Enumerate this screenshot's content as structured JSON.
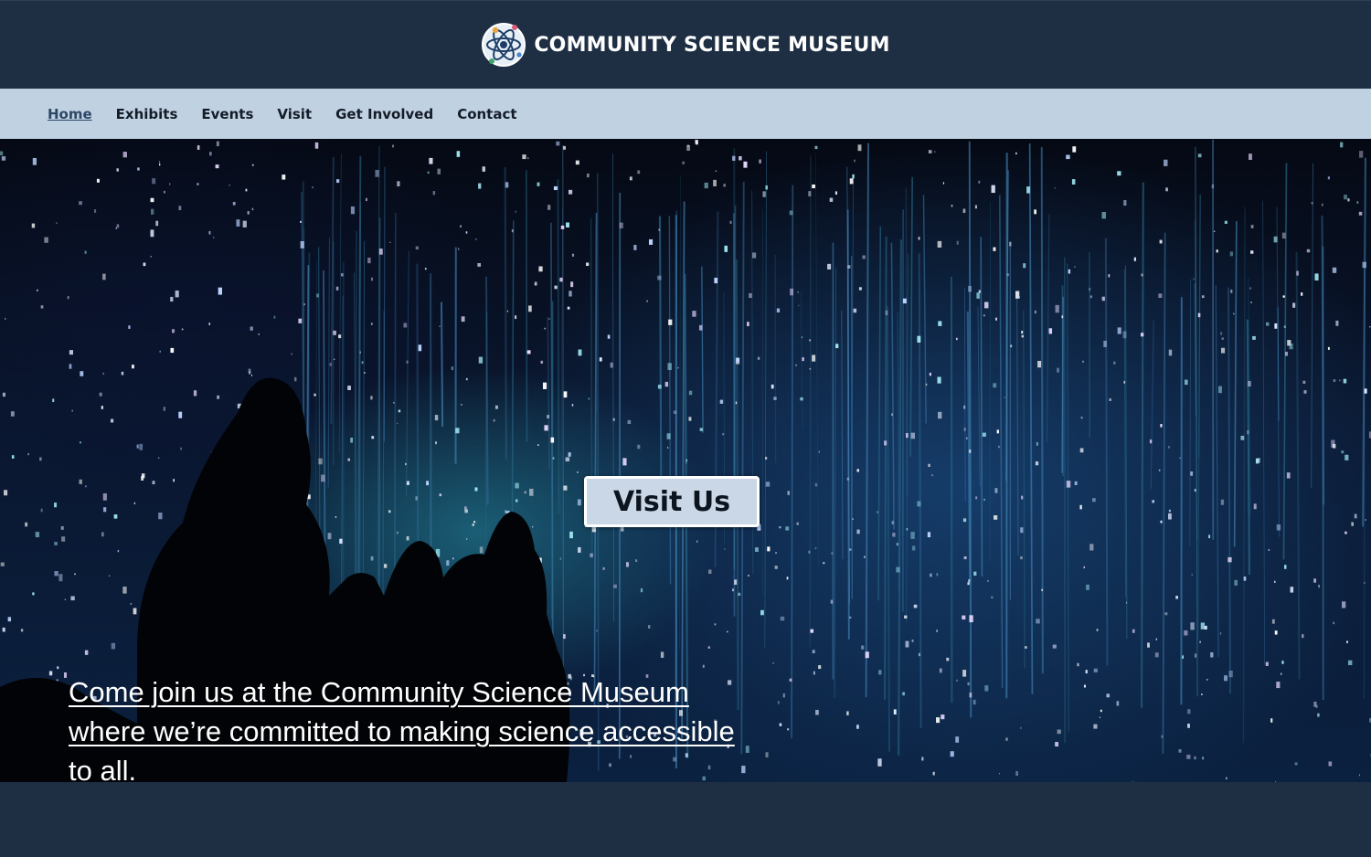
{
  "header": {
    "title": "COMMUNITY SCIENCE MUSEUM",
    "logo_icon": "atom-icon"
  },
  "nav": {
    "items": [
      {
        "label": "Home",
        "active": true
      },
      {
        "label": "Exhibits",
        "active": false
      },
      {
        "label": "Events",
        "active": false
      },
      {
        "label": "Visit",
        "active": false
      },
      {
        "label": "Get Involved",
        "active": false
      },
      {
        "label": "Contact",
        "active": false
      }
    ]
  },
  "hero": {
    "button_label": "Visit Us",
    "tagline": "Come join us at the Community Science Museum where we’re committed to making science accessible to all."
  },
  "colors": {
    "header_bg": "#1e2f44",
    "nav_bg": "#c0d1e2",
    "active_link": "#2d4866",
    "button_bg": "#c9d7e6"
  }
}
